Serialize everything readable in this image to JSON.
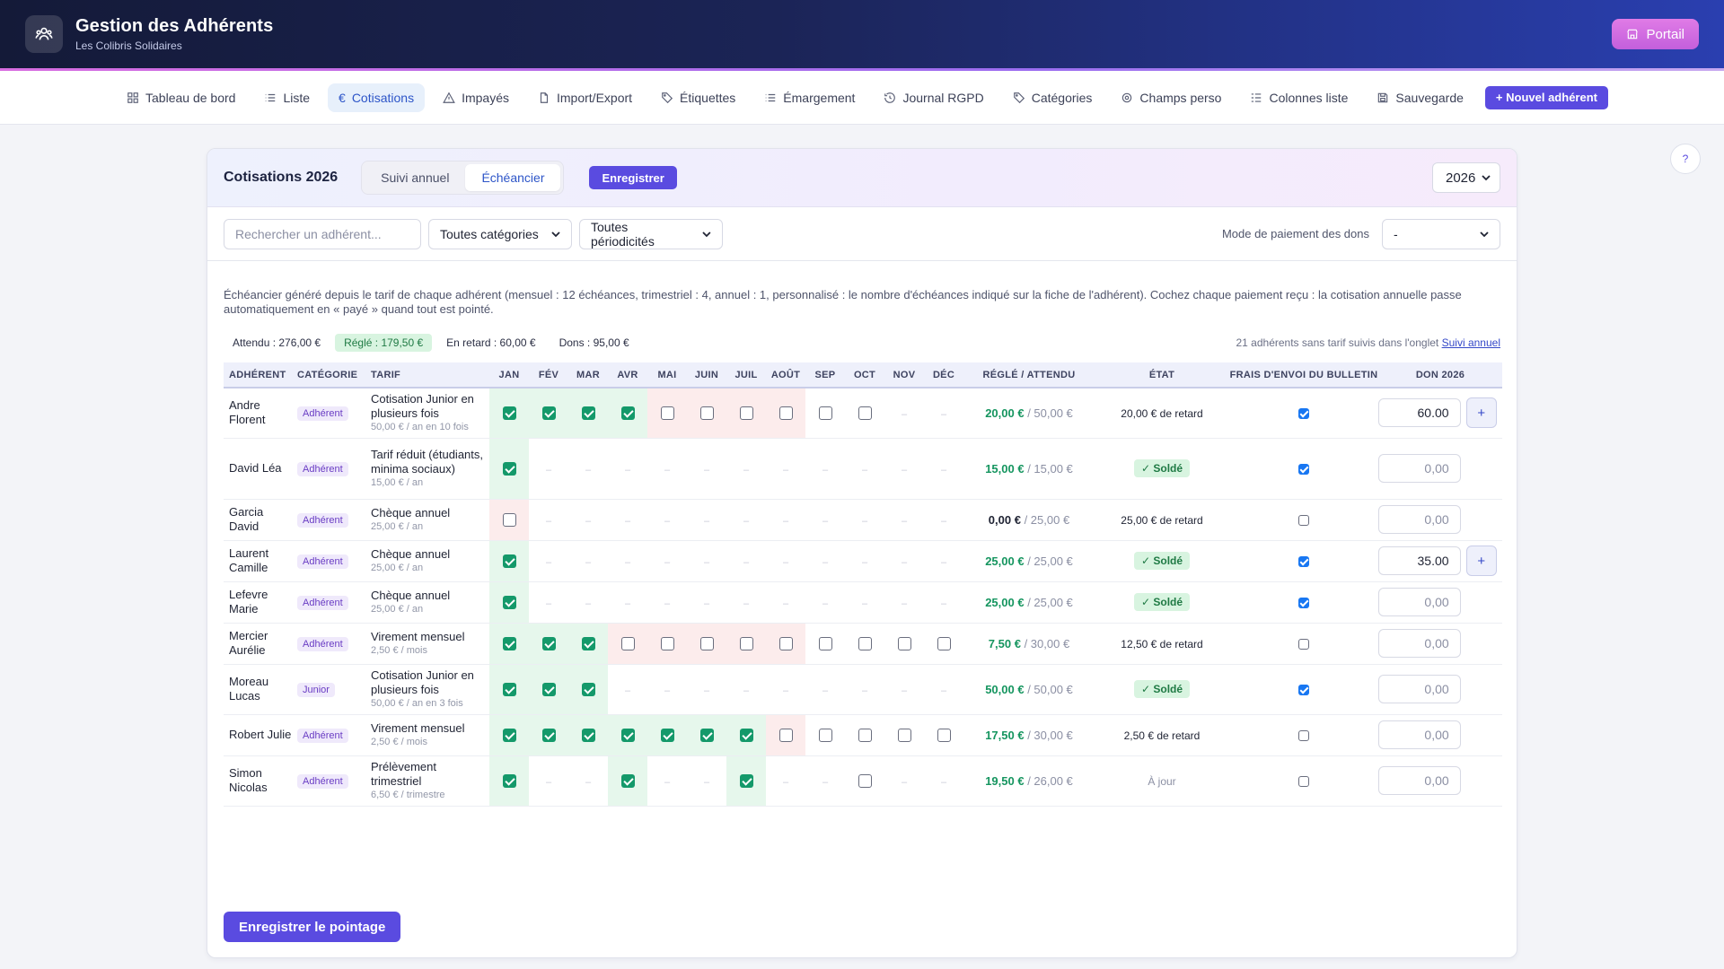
{
  "app": {
    "title": "Gestion des Adhérents",
    "subtitle": "Les Colibris Solidaires",
    "portal_label": "Portail"
  },
  "nav": {
    "items": [
      {
        "label": "Tableau de bord",
        "icon": "grid-icon"
      },
      {
        "label": "Liste",
        "icon": "list-icon"
      },
      {
        "label": "Cotisations",
        "icon": "euro-icon",
        "active": true
      },
      {
        "label": "Impayés",
        "icon": "warning-icon"
      },
      {
        "label": "Import/Export",
        "icon": "file-icon"
      },
      {
        "label": "Étiquettes",
        "icon": "tag-icon"
      },
      {
        "label": "Émargement",
        "icon": "list-icon"
      },
      {
        "label": "Journal RGPD",
        "icon": "history-icon"
      },
      {
        "label": "Catégories",
        "icon": "tag-icon"
      },
      {
        "label": "Champs perso",
        "icon": "gear-icon"
      },
      {
        "label": "Colonnes liste",
        "icon": "columns-icon"
      },
      {
        "label": "Sauvegarde",
        "icon": "save-icon"
      }
    ],
    "new_label": "+ Nouvel adhérent"
  },
  "help_label": "?",
  "card": {
    "title": "Cotisations 2026",
    "tabs": [
      "Suivi annuel",
      "Échéancier"
    ],
    "active_tab": "Échéancier",
    "save_label": "Enregistrer",
    "year": "2026"
  },
  "filters": {
    "search_placeholder": "Rechercher un adhérent...",
    "category": "Toutes catégories",
    "periodicity": "Toutes périodicités",
    "don_mode_label": "Mode de paiement des dons",
    "don_mode_value": "-"
  },
  "info_text": "Échéancier généré depuis le tarif de chaque adhérent (mensuel : 12 échéances, trimestriel : 4, annuel : 1, personnalisé : le nombre d'échéances indiqué sur la fiche de l'adhérent). Cochez chaque paiement reçu : la cotisation annuelle passe automatiquement en « payé » quand tout est pointé.",
  "stats": {
    "attendu": "Attendu : 276,00 €",
    "regle": "Réglé : 179,50 €",
    "retard": "En retard : 60,00 €",
    "dons": "Dons : 95,00 €",
    "right_text": "21 adhérents sans tarif suivis dans l'onglet",
    "right_link": "Suivi annuel"
  },
  "table": {
    "headers": {
      "adherent": "Adhérent",
      "categorie": "Catégorie",
      "tarif": "Tarif",
      "months": [
        "Jan",
        "Fév",
        "Mar",
        "Avr",
        "Mai",
        "Juin",
        "Juil",
        "Août",
        "Sep",
        "Oct",
        "Nov",
        "Déc"
      ],
      "regle": "Réglé / Attendu",
      "etat": "État",
      "frais": "Frais d'envoi du bulletin",
      "don": "Don 2026"
    },
    "rows": [
      {
        "name": "Andre Florent",
        "category": "Adhérent",
        "tarif": "Cotisation Junior en plusieurs fois",
        "tarif_sub": "50,00 € / an en 10 fois",
        "months": [
          "c",
          "c",
          "c",
          "c",
          "u",
          "u",
          "u",
          "u",
          "n",
          "n",
          "-",
          "-"
        ],
        "paid": "20,00 €",
        "expected": "/ 50,00 €",
        "etat": "20,00 € de retard",
        "etat_type": "late",
        "frais": true,
        "don": "60.00",
        "don_filled": true,
        "plus": true
      },
      {
        "name": "David Léa",
        "category": "Adhérent",
        "tarif": "Tarif réduit (étudiants, minima sociaux)",
        "tarif_sub": "15,00 € / an",
        "months": [
          "c",
          "-",
          "-",
          "-",
          "-",
          "-",
          "-",
          "-",
          "-",
          "-",
          "-",
          "-"
        ],
        "paid": "15,00 €",
        "expected": "/ 15,00 €",
        "etat": "✓ Soldé",
        "etat_type": "solde",
        "frais": true,
        "don": "0,00",
        "don_filled": false,
        "plus": false
      },
      {
        "name": "Garcia David",
        "category": "Adhérent",
        "tarif": "Chèque annuel",
        "tarif_sub": "25,00 € / an",
        "months": [
          "u",
          "-",
          "-",
          "-",
          "-",
          "-",
          "-",
          "-",
          "-",
          "-",
          "-",
          "-"
        ],
        "paid": "0,00 €",
        "expected": "/ 25,00 €",
        "etat": "25,00 € de retard",
        "etat_type": "late",
        "frais": false,
        "don": "0,00",
        "don_filled": false,
        "plus": false
      },
      {
        "name": "Laurent Camille",
        "category": "Adhérent",
        "tarif": "Chèque annuel",
        "tarif_sub": "25,00 € / an",
        "months": [
          "c",
          "-",
          "-",
          "-",
          "-",
          "-",
          "-",
          "-",
          "-",
          "-",
          "-",
          "-"
        ],
        "paid": "25,00 €",
        "expected": "/ 25,00 €",
        "etat": "✓ Soldé",
        "etat_type": "solde",
        "frais": true,
        "don": "35.00",
        "don_filled": true,
        "plus": true
      },
      {
        "name": "Lefevre Marie",
        "category": "Adhérent",
        "tarif": "Chèque annuel",
        "tarif_sub": "25,00 € / an",
        "months": [
          "c",
          "-",
          "-",
          "-",
          "-",
          "-",
          "-",
          "-",
          "-",
          "-",
          "-",
          "-"
        ],
        "paid": "25,00 €",
        "expected": "/ 25,00 €",
        "etat": "✓ Soldé",
        "etat_type": "solde",
        "frais": true,
        "don": "0,00",
        "don_filled": false,
        "plus": false
      },
      {
        "name": "Mercier Aurélie",
        "category": "Adhérent",
        "tarif": "Virement mensuel",
        "tarif_sub": "2,50 € / mois",
        "months": [
          "c",
          "c",
          "c",
          "u",
          "u",
          "u",
          "u",
          "u",
          "n",
          "n",
          "n",
          "n"
        ],
        "paid": "7,50 €",
        "expected": "/ 30,00 €",
        "etat": "12,50 € de retard",
        "etat_type": "late",
        "frais": false,
        "don": "0,00",
        "don_filled": false,
        "plus": false
      },
      {
        "name": "Moreau Lucas",
        "category": "Junior",
        "tarif": "Cotisation Junior en plusieurs fois",
        "tarif_sub": "50,00 € / an en 3 fois",
        "months": [
          "c",
          "c",
          "c",
          "-",
          "-",
          "-",
          "-",
          "-",
          "-",
          "-",
          "-",
          "-"
        ],
        "paid": "50,00 €",
        "expected": "/ 50,00 €",
        "etat": "✓ Soldé",
        "etat_type": "solde",
        "frais": true,
        "don": "0,00",
        "don_filled": false,
        "plus": false
      },
      {
        "name": "Robert Julie",
        "category": "Adhérent",
        "tarif": "Virement mensuel",
        "tarif_sub": "2,50 € / mois",
        "months": [
          "c",
          "c",
          "c",
          "c",
          "c",
          "c",
          "c",
          "u",
          "n",
          "n",
          "n",
          "n"
        ],
        "paid": "17,50 €",
        "expected": "/ 30,00 €",
        "etat": "2,50 € de retard",
        "etat_type": "late",
        "frais": false,
        "don": "0,00",
        "don_filled": false,
        "plus": false
      },
      {
        "name": "Simon Nicolas",
        "category": "Adhérent",
        "tarif": "Prélèvement trimestriel",
        "tarif_sub": "6,50 € / trimestre",
        "months": [
          "c",
          "-",
          "-",
          "c",
          "-",
          "-",
          "c",
          "-",
          "-",
          "n",
          "-",
          "-"
        ],
        "paid": "19,50 €",
        "expected": "/ 26,00 €",
        "etat": "À jour",
        "etat_type": "ajour",
        "frais": false,
        "don": "0,00",
        "don_filled": false,
        "plus": false
      }
    ]
  },
  "submit_label": "Enregistrer le pointage",
  "colors": {
    "accent": "#5a4be0",
    "paid": "#15955f",
    "checkbox": "#14996a",
    "late_bg": "#fcecec",
    "paid_bg": "#e6f7ec"
  }
}
